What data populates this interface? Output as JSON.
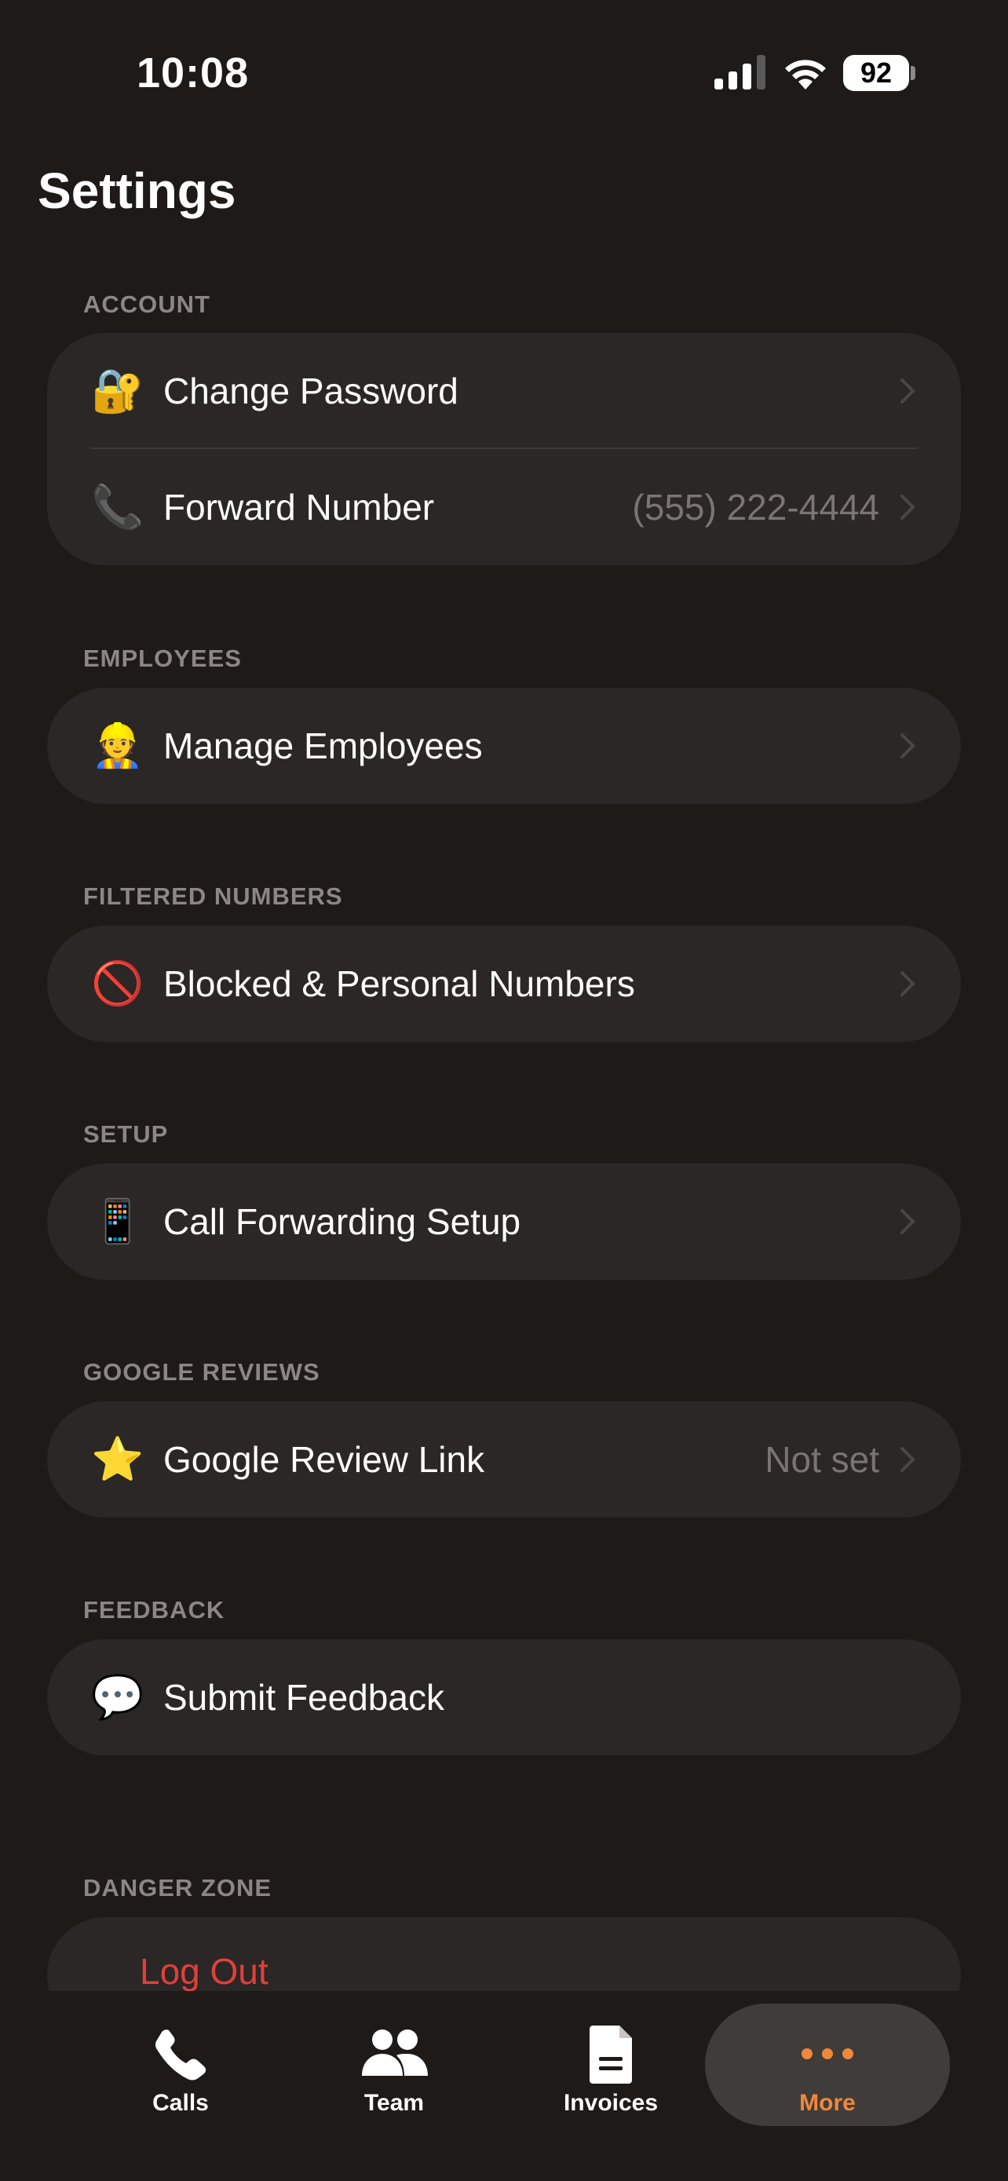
{
  "status_bar": {
    "time": "10:08",
    "battery": "92"
  },
  "page_title": "Settings",
  "sections": {
    "account": {
      "header": "ACCOUNT",
      "rows": [
        {
          "icon": "🔐",
          "icon_name": "lock-key-icon",
          "label": "Change Password",
          "value": ""
        },
        {
          "icon": "📞",
          "icon_name": "telephone-icon",
          "label": "Forward Number",
          "value": "(555) 222-4444"
        }
      ]
    },
    "employees": {
      "header": "EMPLOYEES",
      "rows": [
        {
          "icon": "👷",
          "icon_name": "construction-worker-icon",
          "label": "Manage Employees",
          "value": ""
        }
      ]
    },
    "filtered": {
      "header": "FILTERED NUMBERS",
      "rows": [
        {
          "icon": "🚫",
          "icon_name": "prohibited-icon",
          "label": "Blocked & Personal Numbers",
          "value": ""
        }
      ]
    },
    "setup": {
      "header": "SETUP",
      "rows": [
        {
          "icon": "📱",
          "icon_name": "mobile-phone-icon",
          "label": "Call Forwarding Setup",
          "value": ""
        }
      ]
    },
    "google_reviews": {
      "header": "GOOGLE REVIEWS",
      "rows": [
        {
          "icon": "⭐",
          "icon_name": "star-icon",
          "label": "Google Review Link",
          "value": "Not set"
        }
      ]
    },
    "feedback": {
      "header": "FEEDBACK",
      "rows": [
        {
          "icon": "💬",
          "icon_name": "speech-bubble-icon",
          "label": "Submit Feedback",
          "value": ""
        }
      ]
    },
    "danger": {
      "header": "DANGER ZONE",
      "rows": [
        {
          "label": "Log Out"
        }
      ]
    }
  },
  "tab_bar": {
    "tabs": [
      {
        "label": "Calls",
        "icon_name": "phone-icon"
      },
      {
        "label": "Team",
        "icon_name": "people-icon"
      },
      {
        "label": "Invoices",
        "icon_name": "document-icon"
      },
      {
        "label": "More",
        "icon_name": "ellipsis-icon",
        "active": true
      }
    ]
  },
  "colors": {
    "accent": "#f0883a",
    "danger": "#e0403b",
    "background": "#1d1a18",
    "card": "#2a2726"
  }
}
